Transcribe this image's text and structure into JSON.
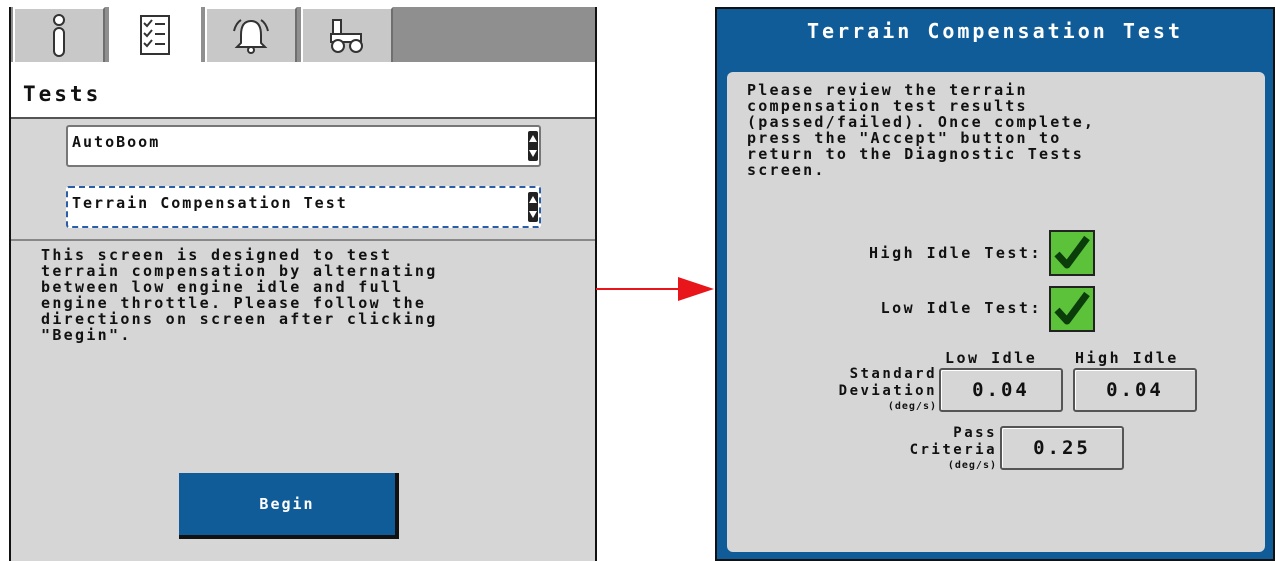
{
  "left_screen": {
    "tabs": [
      {
        "icon": "info-icon",
        "active": false
      },
      {
        "icon": "checklist-icon",
        "active": true
      },
      {
        "icon": "alarm-bell-icon",
        "active": false
      },
      {
        "icon": "machine-icon",
        "active": false
      }
    ],
    "title": "Tests",
    "system_select": {
      "value": "AutoBoom"
    },
    "test_select": {
      "value": "Terrain Compensation Test"
    },
    "description": "This screen is designed to test\nterrain compensation by alternating\nbetween low engine idle and full\nengine throttle. Please follow the\ndirections on screen after clicking\n\"Begin\".",
    "begin_label": "Begin"
  },
  "right_screen": {
    "title": "Terrain Compensation Test",
    "instructions": "Please review the terrain\ncompensation test results\n(passed/failed). Once complete,\npress the \"Accept\" button to\nreturn to the Diagnostic Tests\nscreen.",
    "high_idle_label": "High Idle Test:",
    "high_idle_passed": true,
    "low_idle_label": "Low Idle Test:",
    "low_idle_passed": true,
    "col_low_idle": "Low Idle",
    "col_high_idle": "High Idle",
    "std_dev_label_1": "Standard",
    "std_dev_label_2": "Deviation",
    "std_dev_unit": "(deg/s)",
    "std_dev_low": "0.04",
    "std_dev_high": "0.04",
    "pass_label_1": "Pass",
    "pass_label_2": "Criteria",
    "pass_unit": "(deg/s)",
    "pass_value": "0.25"
  },
  "colors": {
    "arrow": "#e8161b",
    "button_blue": "#0f5c99",
    "check_green": "#5cc23a"
  }
}
